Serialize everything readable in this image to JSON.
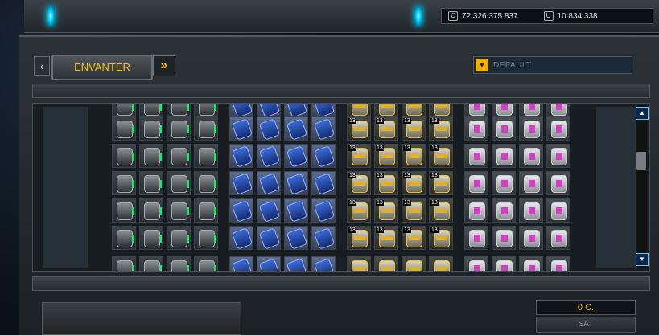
{
  "currency": {
    "credits": "72.326.375.837",
    "uridium": "10.834.338"
  },
  "inventory": {
    "tab_label": "ENVANTER",
    "dropdown_value": "DEFAULT"
  },
  "groups": [
    {
      "name": "dark",
      "columns": 4
    },
    {
      "name": "blue",
      "columns": 4
    },
    {
      "name": "gold",
      "columns": 4
    },
    {
      "name": "pink",
      "columns": 4
    }
  ],
  "badge_text": "13",
  "footer": {
    "price": "0 C.",
    "sell_label": "SAT"
  }
}
